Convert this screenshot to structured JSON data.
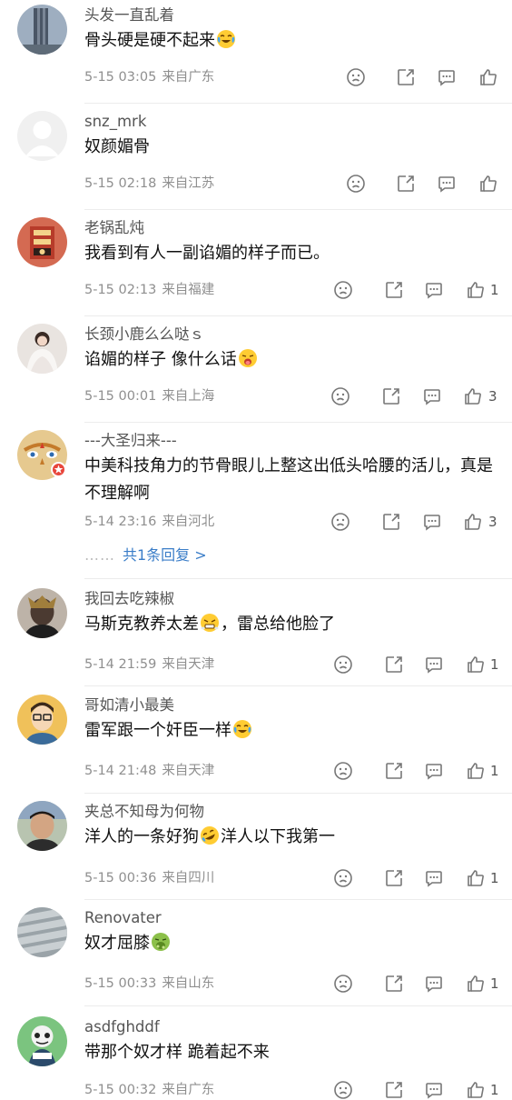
{
  "comments": [
    {
      "user": "头发一直乱着",
      "text": "骨头硬是硬不起来",
      "emoji": "laugh-cry",
      "time": "5-15 03:05",
      "location": "来自广东",
      "likes": "",
      "avatar": "building"
    },
    {
      "user": "snz_mrk",
      "text": "奴颜媚骨",
      "emoji": "",
      "time": "5-15 02:18",
      "location": "来自江苏",
      "likes": "",
      "avatar": "default"
    },
    {
      "user": "老锅乱炖",
      "text": "我看到有人一副谄媚的样子而已。",
      "emoji": "",
      "time": "5-15 02:13",
      "location": "来自福建",
      "likes": "1",
      "avatar": "red-seal"
    },
    {
      "user": "长颈小鹿么么哒ｓ",
      "text": "谄媚的样子 像什么话",
      "emoji": "grimace",
      "time": "5-15 00:01",
      "location": "来自上海",
      "likes": "3",
      "avatar": "woman-dress"
    },
    {
      "user": "---大圣归来---",
      "text": "中美科技角力的节骨眼儿上整这出低头哈腰的活儿，真是不理解啊",
      "emoji": "",
      "time": "5-14 23:16",
      "location": "来自河北",
      "likes": "3",
      "avatar": "monkey-king",
      "badge": true,
      "replies": "共1条回复 >"
    },
    {
      "user": "我回去吃辣椒",
      "text_before": "马斯克教养太差",
      "emoji": "angry-steam",
      "text_after": "，雷总给他脸了",
      "time": "5-14 21:59",
      "location": "来自天津",
      "likes": "1",
      "avatar": "dark-man"
    },
    {
      "user": "哥如清小最美",
      "text": "雷军跟一个奸臣一样",
      "emoji": "laugh-cry",
      "time": "5-14 21:48",
      "location": "来自天津",
      "likes": "1",
      "avatar": "cartoon-man"
    },
    {
      "user": "夹总不知母为何物",
      "text_before": "洋人的一条好狗",
      "emoji": "rofl",
      "text_after": "洋人以下我第一",
      "time": "5-15 00:36",
      "location": "来自四川",
      "likes": "1",
      "avatar": "photo-man"
    },
    {
      "user": "Renovater",
      "text": "奴才屈膝",
      "emoji": "vomit",
      "time": "5-15 00:33",
      "location": "来自山东",
      "likes": "1",
      "avatar": "roof"
    },
    {
      "user": "asdfghddf",
      "text": "带那个奴才样 跪着起不来",
      "emoji": "",
      "time": "5-15 00:32",
      "location": "来自广东",
      "likes": "1",
      "avatar": "cartoon-green"
    }
  ],
  "colors": {
    "reply_link": "#3a7dc8",
    "meta": "#8f8f8f",
    "divider": "#ececec"
  },
  "icons": [
    "dislike-face-icon",
    "share-icon",
    "comment-icon",
    "like-icon"
  ]
}
